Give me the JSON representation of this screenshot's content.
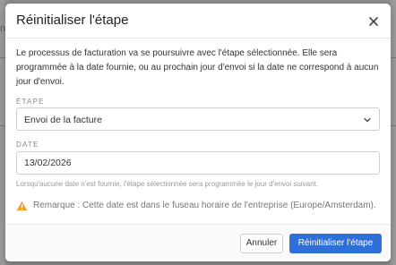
{
  "background": {
    "left_fragment": "n",
    "right_fragment": ""
  },
  "modal": {
    "title": "Réinitialiser l'étape",
    "description": "Le processus de facturation va se poursuivre avec l'étape sélectionnée. Elle sera programmée à la date fournie, ou au prochain jour d'envoi si la date ne correspond à aucun jour d'envoi.",
    "step_field": {
      "label": "ÉTAPE",
      "selected_value": "Envoi de la facture"
    },
    "date_field": {
      "label": "DATE",
      "value": "13/02/2026",
      "hint": "Lorsqu'aucune date n'est fournie, l'étape sélectionnée sera programmée le jour d'envoi suivant."
    },
    "warning": {
      "text": "Remarque : Cette date est dans le fuseau horaire de l'entreprise (Europe/Amsterdam)."
    },
    "buttons": {
      "cancel_label": "Annuler",
      "confirm_label": "Réinitialiser l'étape"
    }
  },
  "icons": {
    "close": "close-icon",
    "chevron": "chevron-down-icon",
    "warning": "warning-icon"
  },
  "colors": {
    "primary": "#2f6fd8",
    "warning": "#f0a020",
    "overlay": "#8c8c8c"
  }
}
